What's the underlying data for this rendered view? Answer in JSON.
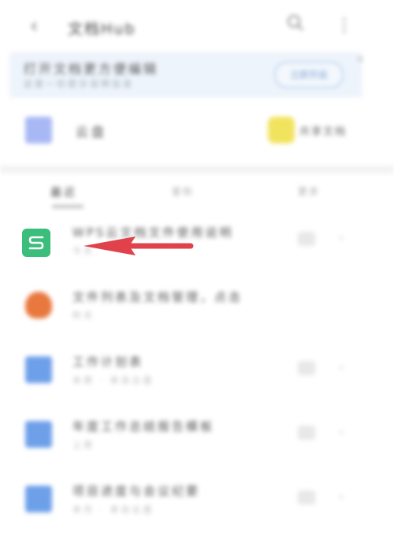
{
  "topbar": {
    "back_icon": "‹",
    "title": "文档Hub",
    "search_icon": "search-icon",
    "more_icon": "⋮"
  },
  "banner": {
    "line1": "打开文档更方便编辑",
    "line2": "这是一份提示说明信息",
    "button": "立即开启",
    "close": "×"
  },
  "quick": {
    "item1_label": "云盘",
    "item2_label": "共享文档"
  },
  "tabs": {
    "tab1": "最近",
    "tab2": "星标",
    "tab3": "更多"
  },
  "rows": [
    {
      "title": "WPS云文档文件使用说明",
      "sub": "今天"
    },
    {
      "title": "文件列表及文档管理，点击",
      "sub": "昨天"
    },
    {
      "title": "工作计划表",
      "sub": "本周 · 来自云盘"
    },
    {
      "title": "年度工作总结报告模板",
      "sub": "上周"
    },
    {
      "title": "项目进度与会议纪要",
      "sub": "本月 · 来自云盘"
    }
  ],
  "highlight_icon": {
    "letter": "S",
    "color": "#3bbd7b"
  },
  "arrow_color": "#e0414b",
  "colors": {
    "doc_icon": "#6ea0ea",
    "orange_icon": "#e8783e",
    "quick1": "#a8b8f4",
    "quick2": "#f2e35e"
  }
}
